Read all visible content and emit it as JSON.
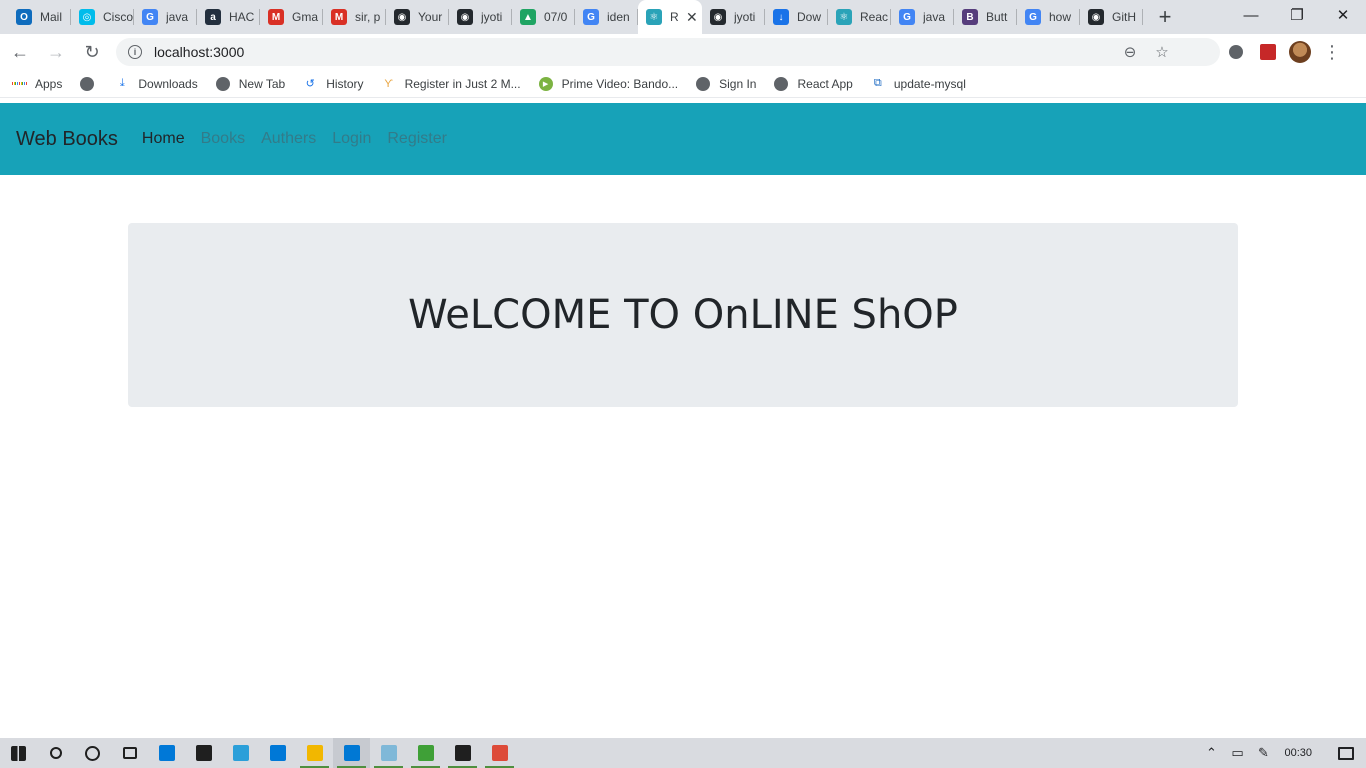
{
  "browser": {
    "tabs": [
      {
        "label": "Mail",
        "icon": "outlook-icon",
        "color": "#0f6cbd",
        "glyph": "O"
      },
      {
        "label": "Cisco",
        "icon": "webex-icon",
        "color": "#00bceb",
        "glyph": "◎"
      },
      {
        "label": "java",
        "icon": "google-icon",
        "color": "#4285f4",
        "glyph": "G"
      },
      {
        "label": "HAC",
        "icon": "amazon-icon",
        "color": "#232f3e",
        "glyph": "a"
      },
      {
        "label": "Gma",
        "icon": "gmail-icon",
        "color": "#d93025",
        "glyph": "M"
      },
      {
        "label": "sir, p",
        "icon": "gmail-icon",
        "color": "#d93025",
        "glyph": "M"
      },
      {
        "label": "Your",
        "icon": "github-icon",
        "color": "#24292e",
        "glyph": "◉"
      },
      {
        "label": "jyoti",
        "icon": "github-icon",
        "color": "#24292e",
        "glyph": "◉"
      },
      {
        "label": "07/0",
        "icon": "drive-icon",
        "color": "#1fa463",
        "glyph": "▲"
      },
      {
        "label": "iden",
        "icon": "google-icon",
        "color": "#4285f4",
        "glyph": "G"
      },
      {
        "label": "R",
        "icon": "react-icon",
        "color": "#2aa3b8",
        "glyph": "⚛",
        "active": true
      },
      {
        "label": "jyoti",
        "icon": "github-icon",
        "color": "#24292e",
        "glyph": "◉"
      },
      {
        "label": "Dow",
        "icon": "download-icon",
        "color": "#1a73e8",
        "glyph": "↓"
      },
      {
        "label": "Reac",
        "icon": "react-icon",
        "color": "#2aa3b8",
        "glyph": "⚛"
      },
      {
        "label": "java",
        "icon": "google-icon",
        "color": "#4285f4",
        "glyph": "G"
      },
      {
        "label": "Butt",
        "icon": "bootstrap-icon",
        "color": "#563d7c",
        "glyph": "B"
      },
      {
        "label": "how",
        "icon": "google-icon",
        "color": "#4285f4",
        "glyph": "G"
      },
      {
        "label": "GitH",
        "icon": "github-icon",
        "color": "#24292e",
        "glyph": "◉"
      }
    ],
    "new_tab_glyph": "+",
    "window_controls": {
      "minimize": "—",
      "restore": "❐",
      "close": "✕"
    },
    "address": "localhost:3000",
    "nav": {
      "back": "←",
      "forward": "→",
      "reload": "↻"
    },
    "omnibox_icons": {
      "zoom": "⊖",
      "star": "☆"
    },
    "menu_glyph": "⋮",
    "bookmarks": [
      {
        "label": "Apps",
        "icon": "apps-grid-icon"
      },
      {
        "label": "",
        "icon": "globe-icon"
      },
      {
        "label": "Downloads",
        "icon": "download-icon"
      },
      {
        "label": "New Tab",
        "icon": "globe-icon"
      },
      {
        "label": "History",
        "icon": "history-icon"
      },
      {
        "label": "Register in Just 2 M...",
        "icon": "register-icon"
      },
      {
        "label": "Prime Video: Bando...",
        "icon": "play-icon"
      },
      {
        "label": "Sign In",
        "icon": "globe-icon"
      },
      {
        "label": "React App",
        "icon": "globe-icon"
      },
      {
        "label": "update-mysql",
        "icon": "bracket-icon"
      }
    ]
  },
  "app": {
    "brand": "Web Books",
    "links": [
      {
        "label": "Home",
        "active": true
      },
      {
        "label": "Books"
      },
      {
        "label": "Authers"
      },
      {
        "label": "Login"
      },
      {
        "label": "Register"
      }
    ],
    "navbar_color": "#17a2b8",
    "hero": {
      "title": "WeLCOME TO OnLINE ShOP"
    }
  },
  "taskbar": {
    "clock": "00:30",
    "apps": [
      {
        "name": "start-icon",
        "color": "#1f1f1f"
      },
      {
        "name": "search-icon",
        "color": "#1f1f1f"
      },
      {
        "name": "cortana-icon",
        "color": "#1f1f1f"
      },
      {
        "name": "task-view-icon",
        "color": "#1f1f1f"
      },
      {
        "name": "edge-icon",
        "color": "#0078d7"
      },
      {
        "name": "store-icon",
        "color": "#1f1f1f"
      },
      {
        "name": "lenovo-icon",
        "color": "#2b9fd9"
      },
      {
        "name": "mail-icon",
        "color": "#0078d7"
      },
      {
        "name": "file-explorer-icon",
        "color": "#f2b700",
        "running": true
      },
      {
        "name": "vscode-icon",
        "color": "#0078d4",
        "running": true,
        "active": true
      },
      {
        "name": "notepad-icon",
        "color": "#7fb8d8",
        "running": true
      },
      {
        "name": "mongodb-icon",
        "color": "#3fa037",
        "running": true
      },
      {
        "name": "terminal-icon",
        "color": "#1f1f1f",
        "running": true
      },
      {
        "name": "chrome-icon",
        "color": "#dd4b39",
        "running": true
      }
    ],
    "tray": {
      "chevron": "⌃",
      "battery": "▭",
      "pen": "✎"
    }
  }
}
